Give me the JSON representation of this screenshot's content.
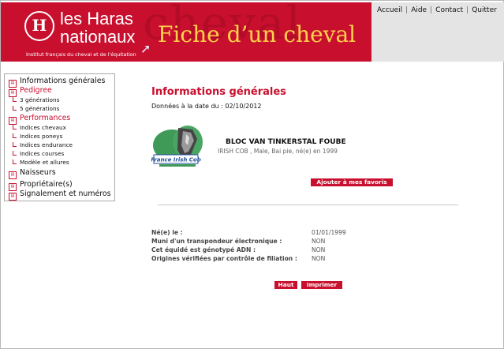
{
  "header": {
    "logo_letter": "H",
    "logo_line1": "les Haras",
    "logo_line2": "nationaux",
    "logo_tagline": "Institut français du cheval et de l'équitation",
    "watermark": "cheval",
    "page_title": "Fiche d’un cheval"
  },
  "top_nav": {
    "items": [
      "Accueil",
      "Aide",
      "Contact",
      "Quitter"
    ],
    "separator": "|"
  },
  "sidebar": {
    "informations": "Informations générales",
    "pedigree": "Pedigree",
    "gen3": "3 générations",
    "gen5": "5 générations",
    "performances": "Performances",
    "indices_chevaux": "Indices chevaux",
    "indices_poneys": "Indices poneys",
    "indices_endurance": "Indices endurance",
    "indices_courses": "Indices courses",
    "modele": "Modèle et allures",
    "naisseurs": "Naisseurs",
    "proprietaires": "Propriétaire(s)",
    "signalement": "Signalement et numéros"
  },
  "main": {
    "title": "Informations générales",
    "date_line": "Données à la date du : 02/10/2012",
    "horse_name": "BLOC VAN TINKERSTAL FOUBE",
    "horse_desc": "IRISH COB , Male, Bai pie, né(e) en 1999",
    "stud_logo_text": "France Irish Cob",
    "fav_button": "Ajouter à mes favoris",
    "details": [
      {
        "label": "Né(e) le :",
        "value": "01/01/1999"
      },
      {
        "label": "Muni d'un transpondeur électronique :",
        "value": "NON"
      },
      {
        "label": "Cet équidé est génotypé ADN :",
        "value": "NON"
      },
      {
        "label": "Origines vérifiées par contrôle de filiation :",
        "value": "NON"
      }
    ],
    "haut_button": "Haut",
    "print_button": "Imprimer"
  },
  "colors": {
    "brand_red": "#c8102e",
    "title_yellow": "#ffd24a"
  }
}
